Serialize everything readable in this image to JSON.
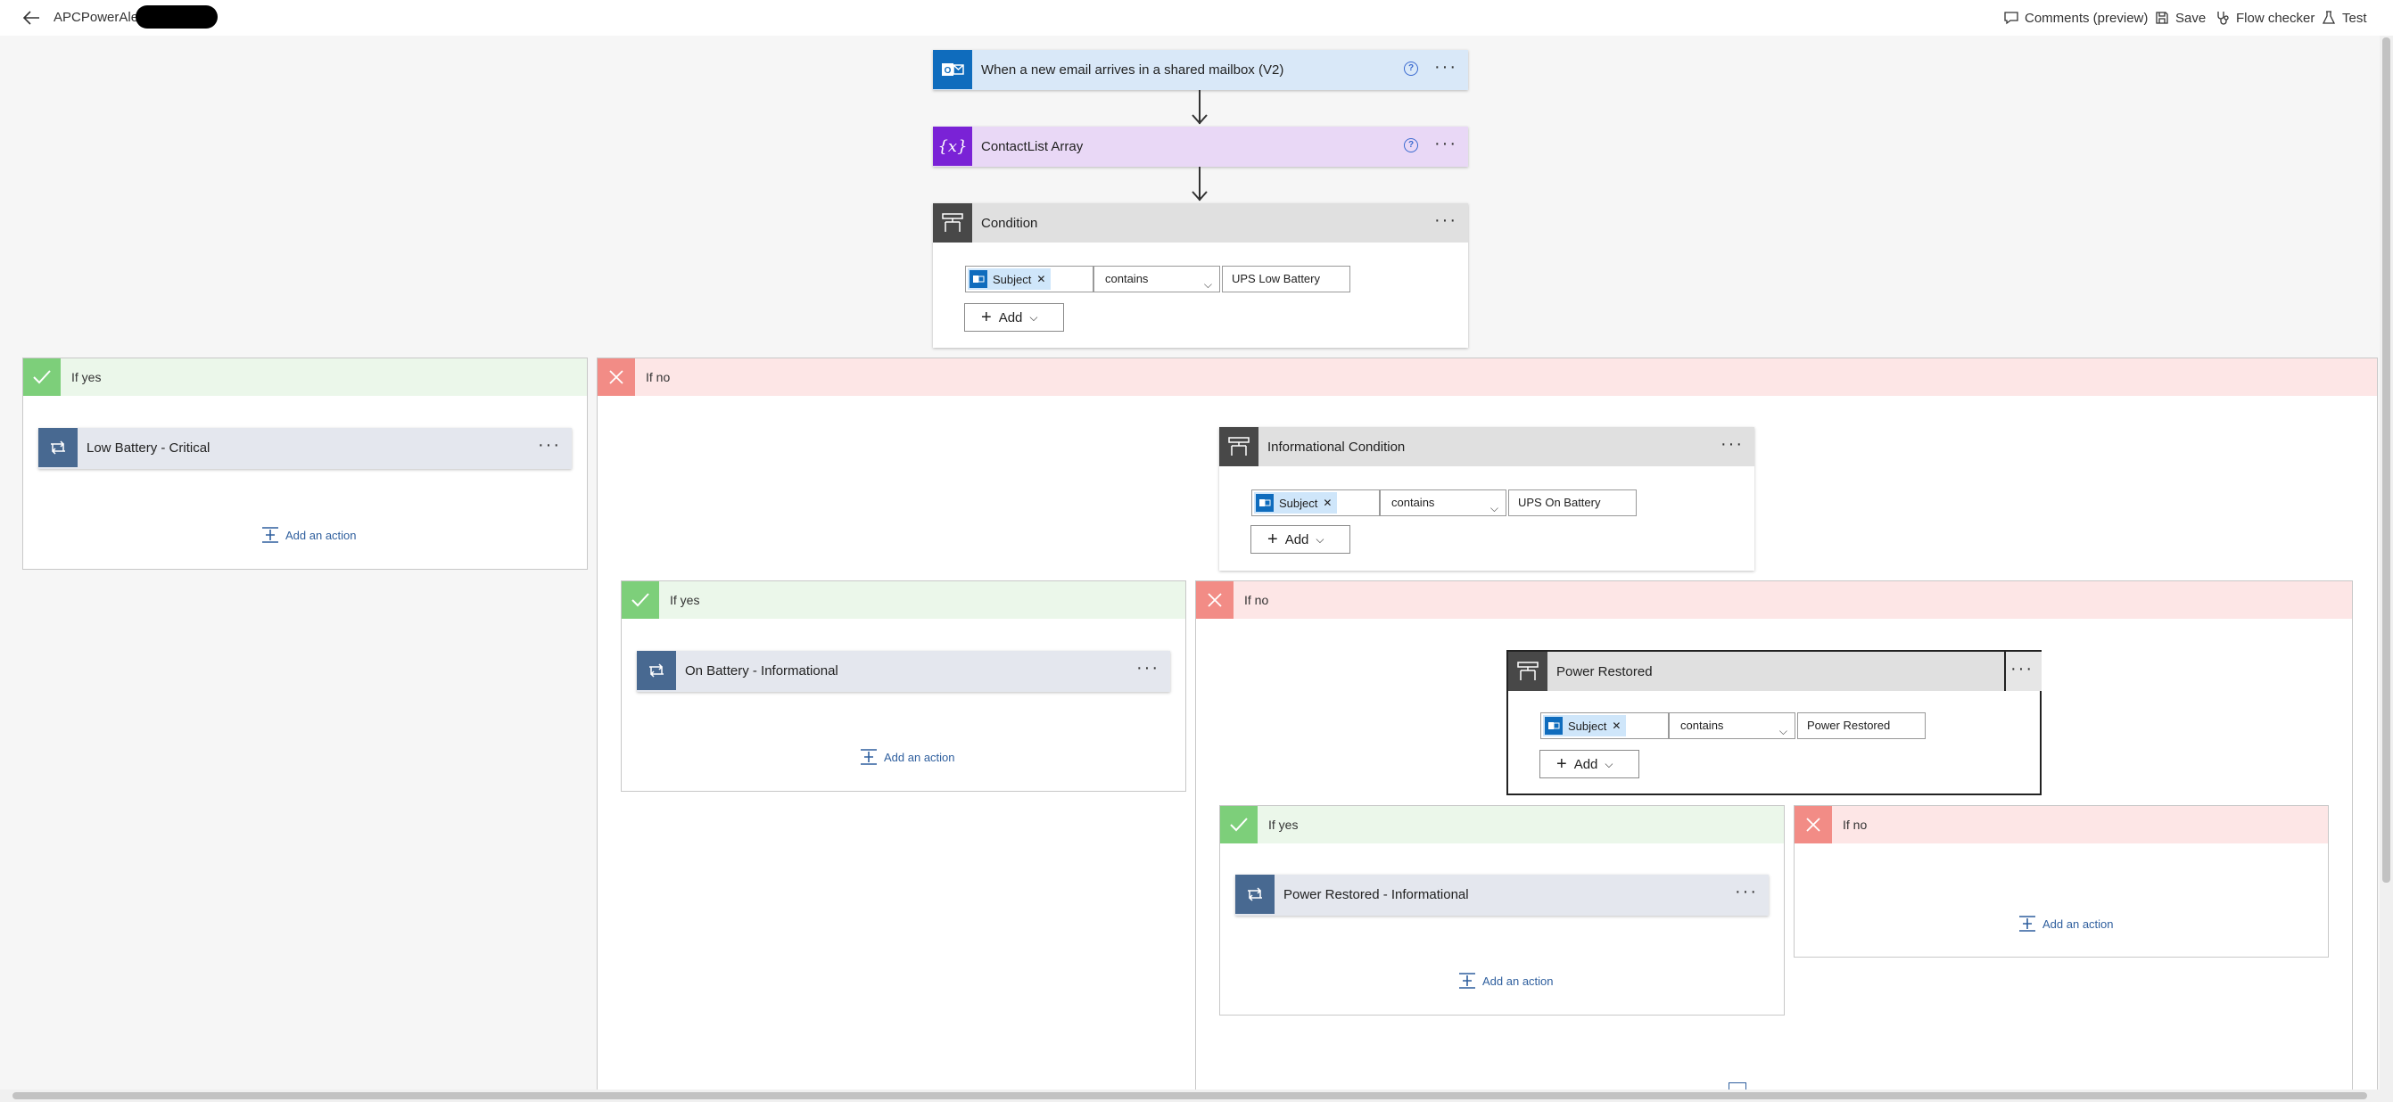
{
  "header": {
    "back": "back-arrow-icon",
    "flow_name": "APCPowerAlert",
    "comments": "Comments (preview)",
    "save": "Save",
    "flow_checker": "Flow checker",
    "test": "Test"
  },
  "colors": {
    "outlook": "#0f6cbd",
    "variable": "#7a22d6",
    "condition": "#484848",
    "loop": "#486991",
    "yes": "#7dcf7a",
    "no": "#f28c86"
  },
  "trigger": {
    "title": "When a new email arrives in a shared mailbox (V2)"
  },
  "contact_list": {
    "title": "ContactList Array"
  },
  "condition1": {
    "title": "Condition",
    "field": "Subject",
    "operator": "contains",
    "value": "UPS Low Battery",
    "add": "Add"
  },
  "branch1_yes": {
    "label": "If yes",
    "action": "Low Battery - Critical",
    "add_action": "Add an action"
  },
  "branch1_no": {
    "label": "If no"
  },
  "condition2": {
    "title": "Informational Condition",
    "field": "Subject",
    "operator": "contains",
    "value": "UPS On Battery",
    "add": "Add"
  },
  "branch2_yes": {
    "label": "If yes",
    "action": "On Battery - Informational",
    "add_action": "Add an action"
  },
  "branch2_no": {
    "label": "If no"
  },
  "condition3": {
    "title": "Power Restored",
    "field": "Subject",
    "operator": "contains",
    "value": "Power Restored",
    "add": "Add"
  },
  "branch3_yes": {
    "label": "If yes",
    "action": "Power Restored - Informational",
    "add_action": "Add an action"
  },
  "branch3_no": {
    "label": "If no",
    "add_action": "Add an action"
  }
}
